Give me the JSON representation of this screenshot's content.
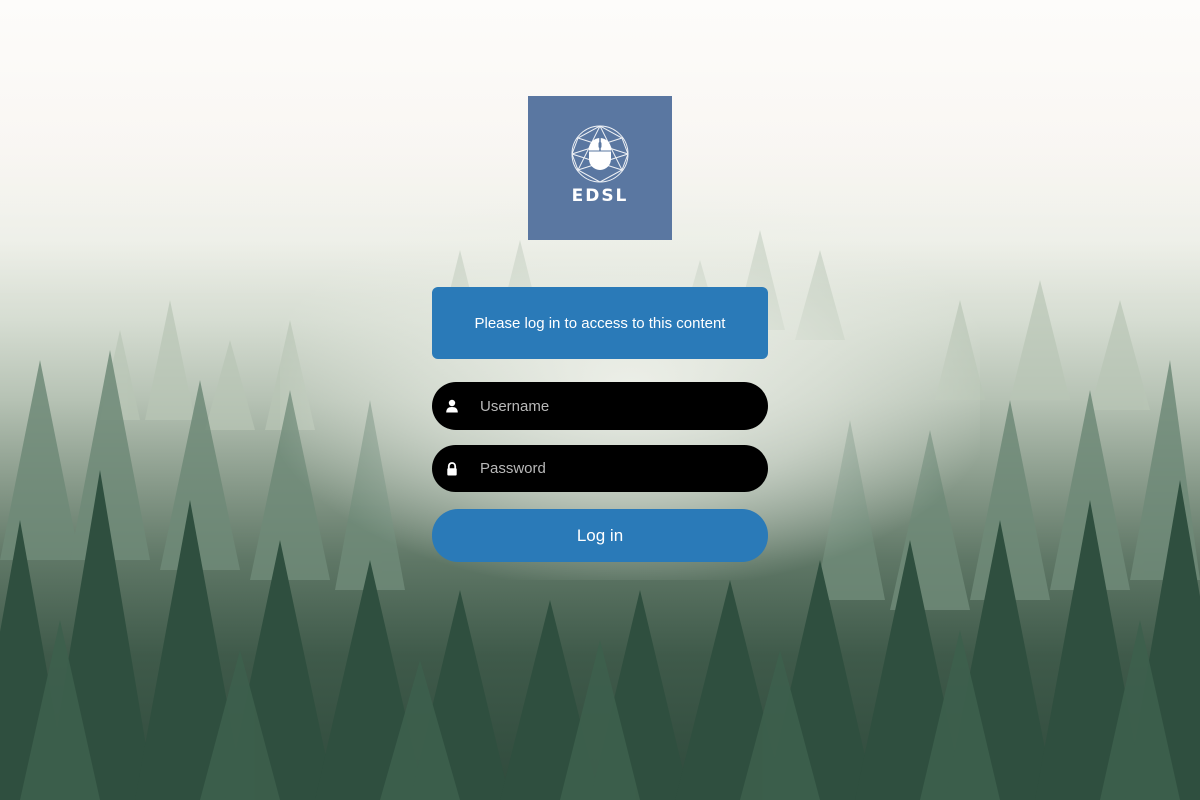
{
  "logo": {
    "text": "EDSL",
    "icon": "mouse-globe-icon",
    "background": "#5a77a1"
  },
  "notice": {
    "text": "Please log in to access to this content",
    "background": "#2a7ab8"
  },
  "username": {
    "placeholder": "Username",
    "value": "",
    "icon": "user-icon"
  },
  "password": {
    "placeholder": "Password",
    "value": "",
    "icon": "lock-icon"
  },
  "login_button": {
    "label": "Log in",
    "background": "#2a7ab8"
  }
}
